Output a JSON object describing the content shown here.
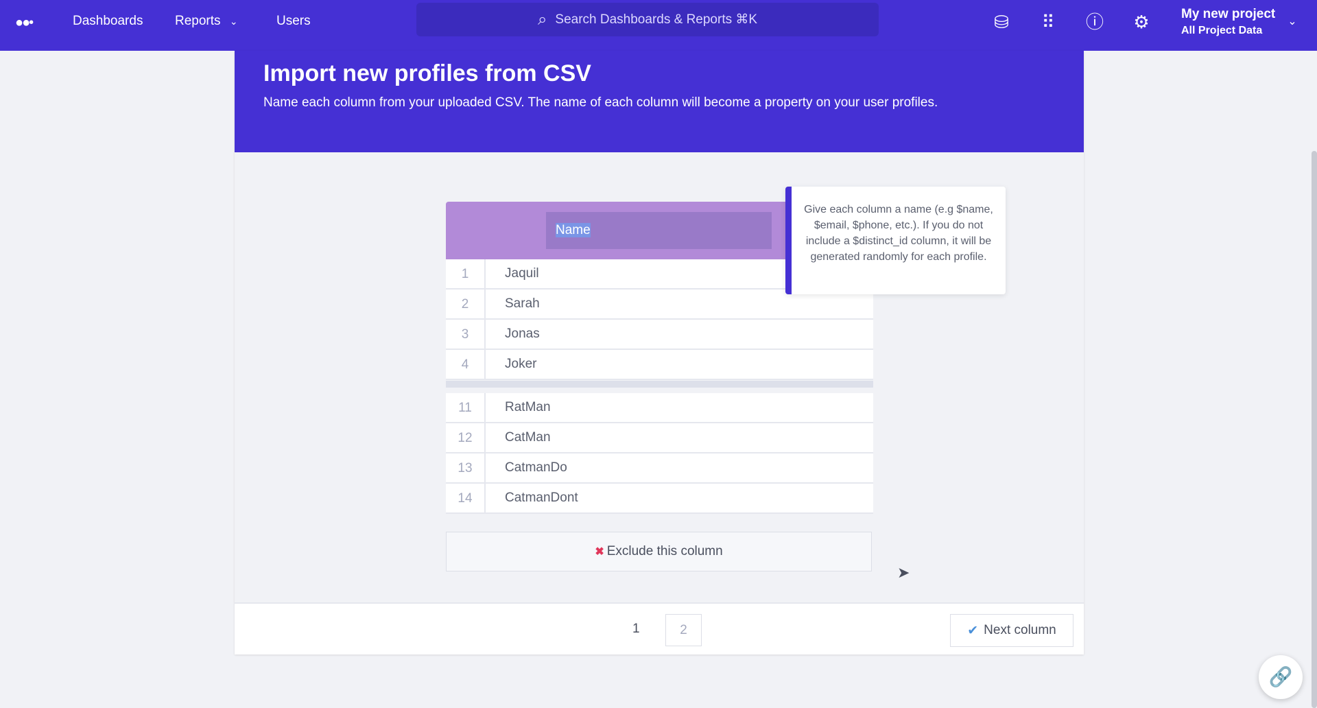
{
  "nav": {
    "items": [
      "Dashboards",
      "Reports",
      "Users"
    ],
    "search_placeholder": "Search Dashboards & Reports ⌘K",
    "project": "My new project",
    "project_sub": "All Project Data"
  },
  "header": {
    "title": "Import new profiles from CSV",
    "subtitle": "Name each column from your uploaded CSV. The name of each column will become a property on your user profiles."
  },
  "column": {
    "name": "Name",
    "rows_top": [
      {
        "n": "1",
        "v": "Jaquil"
      },
      {
        "n": "2",
        "v": "Sarah"
      },
      {
        "n": "3",
        "v": "Jonas"
      },
      {
        "n": "4",
        "v": "Joker"
      }
    ],
    "rows_bottom": [
      {
        "n": "11",
        "v": "RatMan"
      },
      {
        "n": "12",
        "v": "CatMan"
      },
      {
        "n": "13",
        "v": "CatmanDo"
      },
      {
        "n": "14",
        "v": "CatmanDont"
      }
    ],
    "exclude_label": "Exclude this column"
  },
  "tooltip": "Give each column a name (e.g $name, $email, $phone, etc.). If you do not include a $distinct_id column, it will be generated randomly for each profile.",
  "footer": {
    "pages": [
      "1",
      "2"
    ],
    "next_label": "Next column"
  }
}
